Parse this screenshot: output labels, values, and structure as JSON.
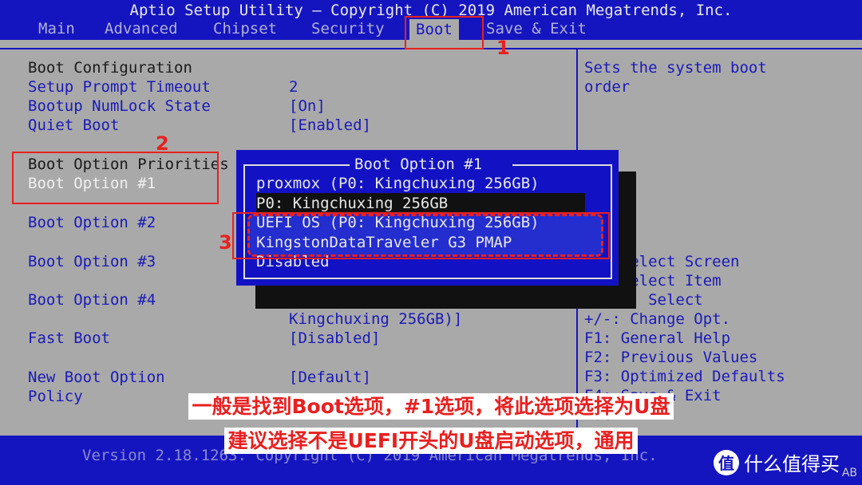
{
  "header": {
    "title": "Aptio Setup Utility – Copyright (C) 2019 American Megatrends, Inc.",
    "tabs": [
      {
        "label": "Main"
      },
      {
        "label": "Advanced"
      },
      {
        "label": "Chipset"
      },
      {
        "label": "Security"
      },
      {
        "label": "Boot"
      },
      {
        "label": "Save & Exit"
      }
    ],
    "active_tab": "Boot"
  },
  "main": {
    "rows": [
      {
        "label": "Boot Configuration",
        "value": ""
      },
      {
        "label": "Setup Prompt Timeout",
        "value": "2"
      },
      {
        "label": "Bootup NumLock State",
        "value": "[On]"
      },
      {
        "label": "Quiet Boot",
        "value": "[Enabled]"
      },
      {
        "label": "Boot Option Priorities",
        "value": ""
      },
      {
        "label": "Boot Option #1",
        "value": ""
      },
      {
        "label": "Boot Option #2",
        "value": ""
      },
      {
        "label": "Boot Option #3",
        "value": ""
      },
      {
        "label": "Boot Option #4",
        "value": ""
      },
      {
        "label": "",
        "value": "Kingchuxing 256GB)]"
      },
      {
        "label": "Fast Boot",
        "value": "[Disabled]"
      },
      {
        "label": "New Boot Option",
        "value": "[Default]"
      },
      {
        "label": "Policy",
        "value": ""
      }
    ]
  },
  "help": {
    "description": [
      "Sets the system boot",
      "order"
    ],
    "keys": [
      "→←: Select Screen",
      "↑↓: Select Item",
      "Enter: Select",
      "+/-: Change Opt.",
      "F1: General Help",
      "F2: Previous Values",
      "F3: Optimized Defaults",
      "F4: Save & Exit",
      "ESC: Exit"
    ]
  },
  "popup": {
    "title": "Boot Option #1",
    "items": [
      "proxmox (P0: Kingchuxing 256GB)",
      "P0: Kingchuxing 256GB",
      "UEFI OS (P0: Kingchuxing 256GB)",
      "KingstonDataTraveler G3 PMAP",
      "Disabled"
    ],
    "selected_index": 1
  },
  "footer": {
    "version": "Version 2.18.1263. Copyright (C) 2019 American Megatrends, Inc."
  },
  "annotations": {
    "markers": [
      "1",
      "2",
      "3"
    ],
    "subtitle_lines": [
      "一般是找到Boot选项，#1选项，将此选项选择为U盘",
      "建议选择不是UEFI开头的U盘启动选项，通用"
    ]
  },
  "watermark": {
    "logo": "值",
    "text": "什么值得买",
    "corner": "AB"
  },
  "colors": {
    "bios_blue": "#1515c0",
    "panel_gray": "#a9a9a9",
    "annotation_red": "#e82020"
  }
}
